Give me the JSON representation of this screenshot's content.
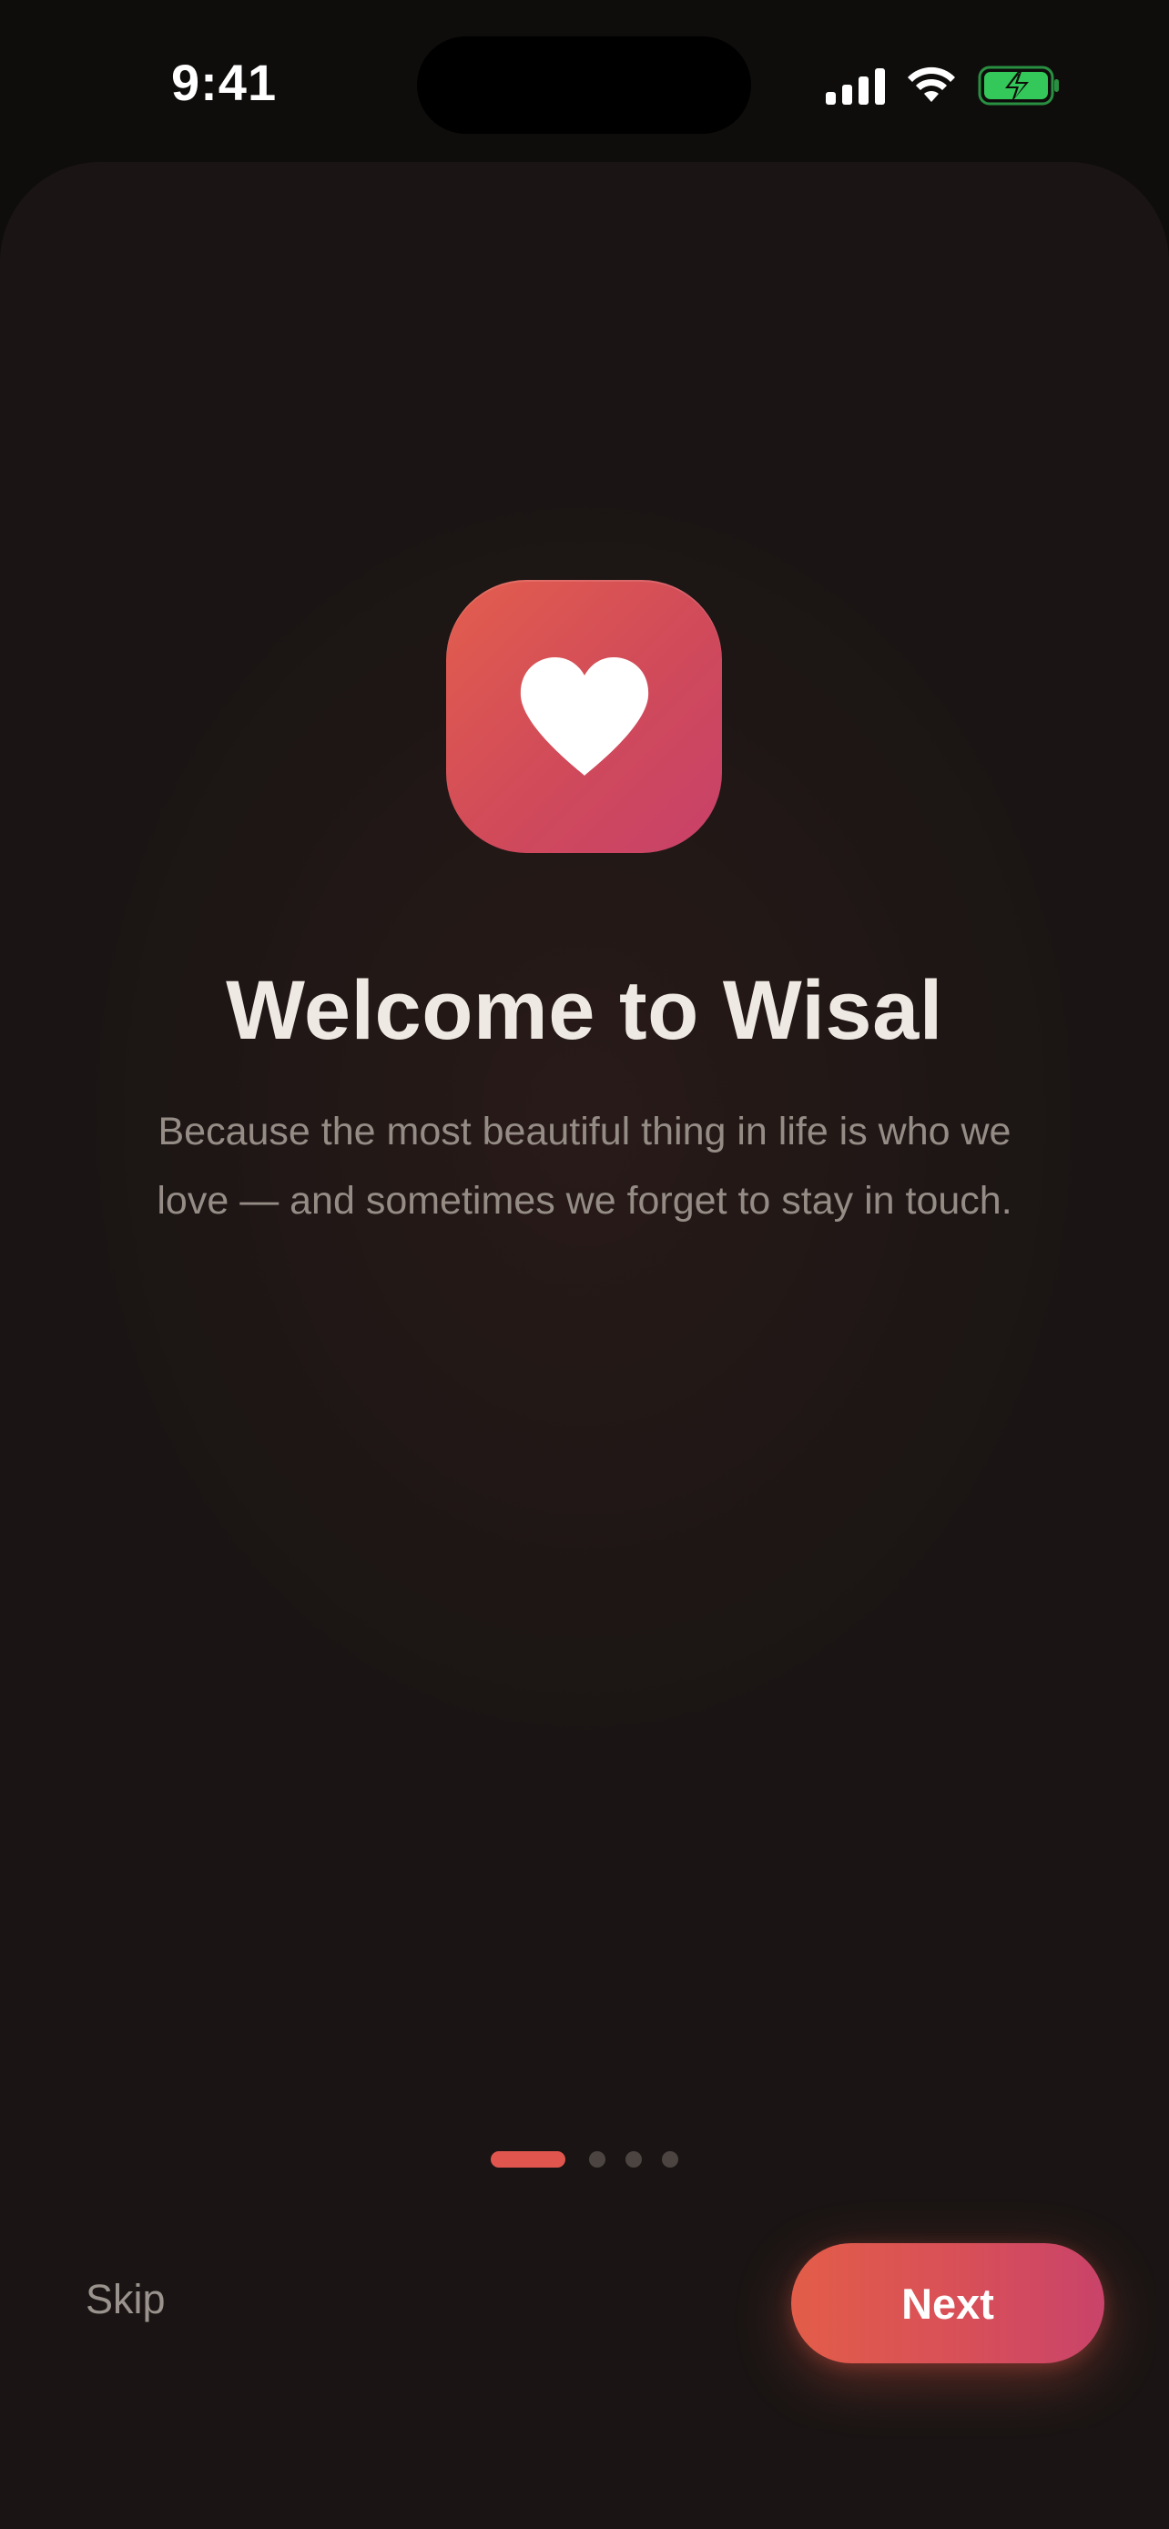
{
  "status_bar": {
    "time": "9:41",
    "icons": [
      "cellular-signal-icon",
      "wifi-icon",
      "battery-charging-icon"
    ]
  },
  "onboarding": {
    "app_icon": "heart-icon",
    "title": "Welcome to Wisal",
    "subtitle": "Because the most beautiful thing in life is who we love — and sometimes we forget to stay in touch.",
    "page_indicator": {
      "current_page": 1,
      "total_pages": 4
    }
  },
  "actions": {
    "skip_label": "Skip",
    "next_label": "Next"
  },
  "colors": {
    "accent": "#e0564e",
    "accent_gradient_end": "#c8416a",
    "background": "#1a1514",
    "title_text": "#efe9e3",
    "body_text": "#958c86",
    "battery_green": "#34c759"
  }
}
